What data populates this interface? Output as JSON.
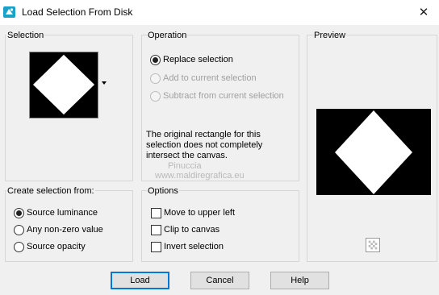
{
  "window": {
    "title": "Load Selection From Disk",
    "close_glyph": "✕"
  },
  "selection": {
    "label": "Selection"
  },
  "operation": {
    "label": "Operation",
    "options": [
      {
        "label": "Replace selection",
        "checked": true,
        "enabled": true
      },
      {
        "label": "Add to current selection",
        "checked": false,
        "enabled": false
      },
      {
        "label": "Subtract from current selection",
        "checked": false,
        "enabled": false
      }
    ],
    "message": "The original rectangle for this selection does not completely intersect the canvas."
  },
  "preview": {
    "label": "Preview"
  },
  "create_from": {
    "label": "Create selection from:",
    "options": [
      {
        "label": "Source luminance",
        "checked": true
      },
      {
        "label": "Any non-zero value",
        "checked": false
      },
      {
        "label": "Source opacity",
        "checked": false
      }
    ]
  },
  "options": {
    "label": "Options",
    "items": [
      {
        "label": "Move to upper left",
        "checked": false
      },
      {
        "label": "Clip to canvas",
        "checked": false
      },
      {
        "label": "Invert selection",
        "checked": false
      }
    ]
  },
  "buttons": {
    "load": "Load",
    "cancel": "Cancel",
    "help": "Help"
  },
  "watermark": {
    "line1": "Pinuccia",
    "line2": "www.maldiregrafica.eu"
  },
  "colors": {
    "accent": "#0078d7",
    "app_icon": "#1aa1c6"
  }
}
